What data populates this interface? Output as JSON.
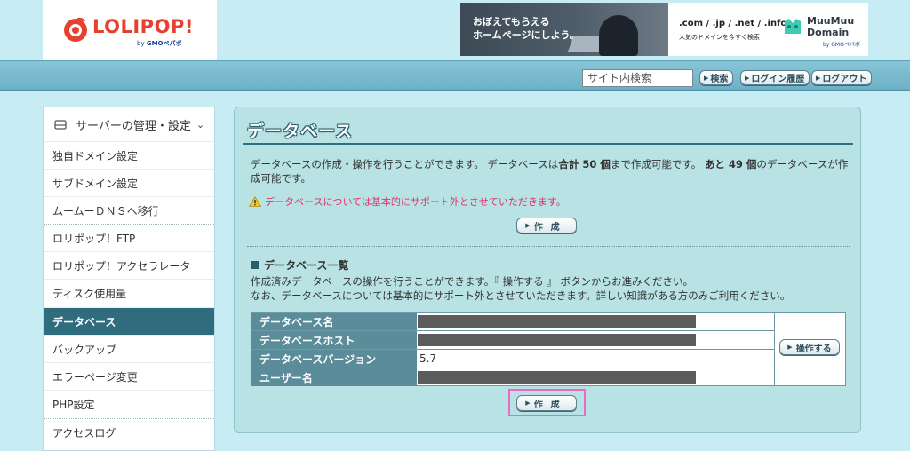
{
  "header": {
    "logo_text": "LOLIPOP!",
    "logo_by": "by",
    "logo_company": "GMOペパボ",
    "banner": {
      "copy_line1": "おぼえてもらえる",
      "copy_line2": "ホームページにしよう。",
      "domains": ".com / .jp / .net / .info",
      "sub": "人気のドメインを今すぐ検索",
      "brand_line1": "MuuMuu",
      "brand_line2": "Domain",
      "brand_by": "by GMOペパボ"
    }
  },
  "navbar": {
    "search_placeholder": "サイト内検索",
    "search_button": "検索",
    "login_history_button": "ログイン履歴",
    "logout_button": "ログアウト"
  },
  "sidebar": {
    "heading": "サーバーの管理・設定",
    "items": [
      {
        "label": "独自ドメイン設定"
      },
      {
        "label": "サブドメイン設定"
      },
      {
        "label": "ムームーＤＮＳへ移行"
      },
      {
        "label": "ロリポップ！FTP"
      },
      {
        "label": "ロリポップ！アクセラレータ"
      },
      {
        "label": "ディスク使用量"
      },
      {
        "label": "データベース"
      },
      {
        "label": "バックアップ"
      },
      {
        "label": "エラーページ変更"
      },
      {
        "label": "PHP設定"
      },
      {
        "label": "アクセスログ"
      }
    ]
  },
  "main": {
    "title": "データベース",
    "intro_1": "データベースの作成・操作を行うことができます。 データベースは",
    "intro_total": "合計 50 個",
    "intro_2": "まで作成可能です。",
    "intro_remaining": "あと 49 個",
    "intro_3": "のデータベースが作成可能です。",
    "warning": "データベースについては基本的にサポート外とさせていただきます。",
    "create_button": "作成",
    "list_heading": "データベース一覧",
    "list_desc_1": "作成済みデータベースの操作を行うことができます。『 操作する 』 ボタンからお進みください。",
    "list_desc_2": "なお、データベースについては基本的にサポート外とさせていただきます。詳しい知識がある方のみご利用ください。",
    "table": {
      "rows": [
        {
          "label": "データベース名",
          "value": ""
        },
        {
          "label": "データベースホスト",
          "value": ""
        },
        {
          "label": "データベースバージョン",
          "value": "5.7"
        },
        {
          "label": "ユーザー名",
          "value": ""
        }
      ],
      "action_button": "操作する"
    },
    "create_button_bottom": "作成"
  },
  "colors": {
    "page_bg": "#c8ecf3",
    "nav_bg": "#7dbccf",
    "sidebar_active": "#2e6c7e",
    "table_label_bg": "#5b8c99",
    "warning_text": "#e0326e",
    "highlight": "#e96bc9"
  }
}
